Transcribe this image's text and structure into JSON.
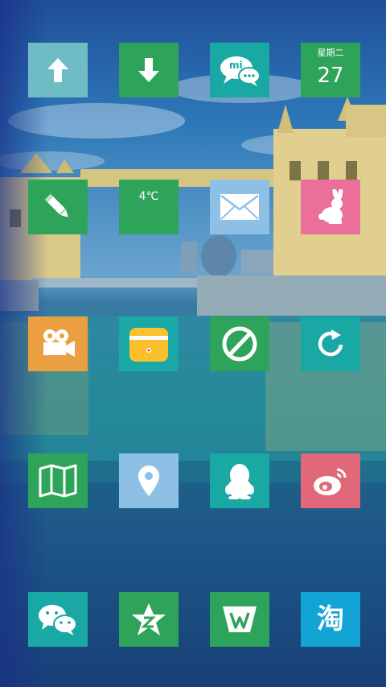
{
  "colors": {
    "teal_light": "#6fbcc4",
    "green": "#2ea45a",
    "teal": "#1aa8a5",
    "blue_light": "#8ec0e6",
    "pink": "#ea6f9b",
    "orange": "#eaa040",
    "red_pink": "#e06878",
    "cyan": "#13a4d6"
  },
  "calendar": {
    "weekday": "星期二",
    "day": "27"
  },
  "weather": {
    "temperature": "4℃"
  },
  "rows": [
    [
      "up-arrow-icon",
      "down-arrow-icon",
      "mi-talk-icon",
      "calendar"
    ],
    [
      "pencil-icon",
      "weather",
      "mail-envelope-icon",
      "rabbit-icon"
    ],
    [
      "video-camera-icon",
      "wallet-card-icon",
      "block-forbidden-icon",
      "refresh-icon"
    ],
    [
      "map-icon",
      "location-pin-icon",
      "qq-penguin-icon",
      "weibo-icon"
    ],
    [
      "wechat-icon",
      "star-app-icon",
      "wps-office-icon",
      "taobao-icon"
    ]
  ],
  "mi_logo_text": "mi",
  "taobao_glyph": "淘"
}
